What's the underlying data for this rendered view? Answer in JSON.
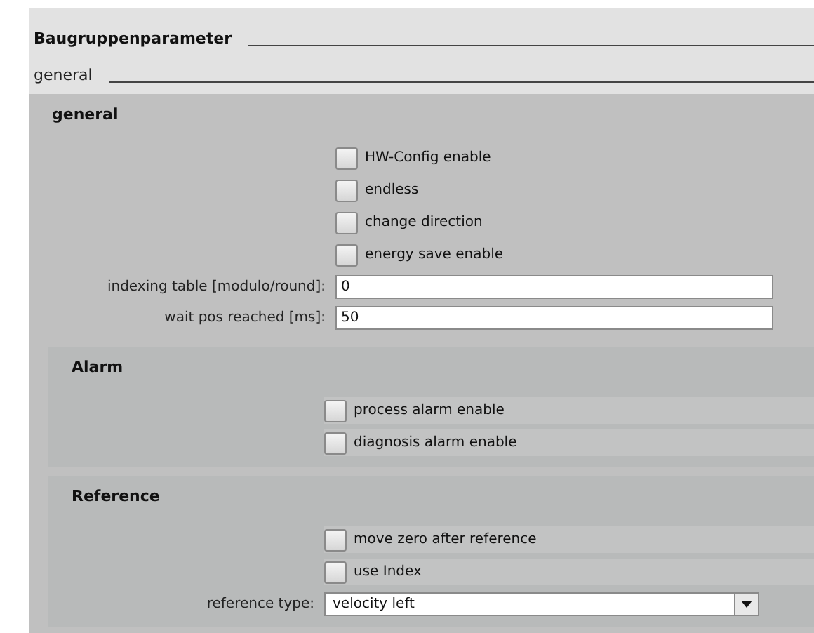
{
  "title": "Baugruppenparameter",
  "subtitle": "general",
  "sections": [
    {
      "title": "general",
      "kind": "main",
      "rows": [
        {
          "kind": "checkbox",
          "label": "HW-Config enable",
          "checked": false
        },
        {
          "kind": "checkbox",
          "label": "endless",
          "checked": false
        },
        {
          "kind": "checkbox",
          "label": "change direction",
          "checked": false
        },
        {
          "kind": "checkbox",
          "label": "energy save enable",
          "checked": false
        },
        {
          "kind": "field",
          "label": "indexing table [modulo/round]:",
          "value": "0"
        },
        {
          "kind": "field",
          "label": "wait pos reached [ms]:",
          "value": "50"
        }
      ]
    },
    {
      "title": "Alarm",
      "kind": "group",
      "rows": [
        {
          "kind": "checkbox",
          "label": "process alarm enable",
          "checked": false
        },
        {
          "kind": "checkbox",
          "label": "diagnosis alarm enable",
          "checked": false
        }
      ]
    },
    {
      "title": "Reference",
      "kind": "group",
      "rows": [
        {
          "kind": "checkbox",
          "label": "move zero after reference",
          "checked": false
        },
        {
          "kind": "checkbox",
          "label": "use Index",
          "checked": false
        },
        {
          "kind": "select",
          "label": "reference type:",
          "value": "velocity left"
        }
      ]
    }
  ]
}
